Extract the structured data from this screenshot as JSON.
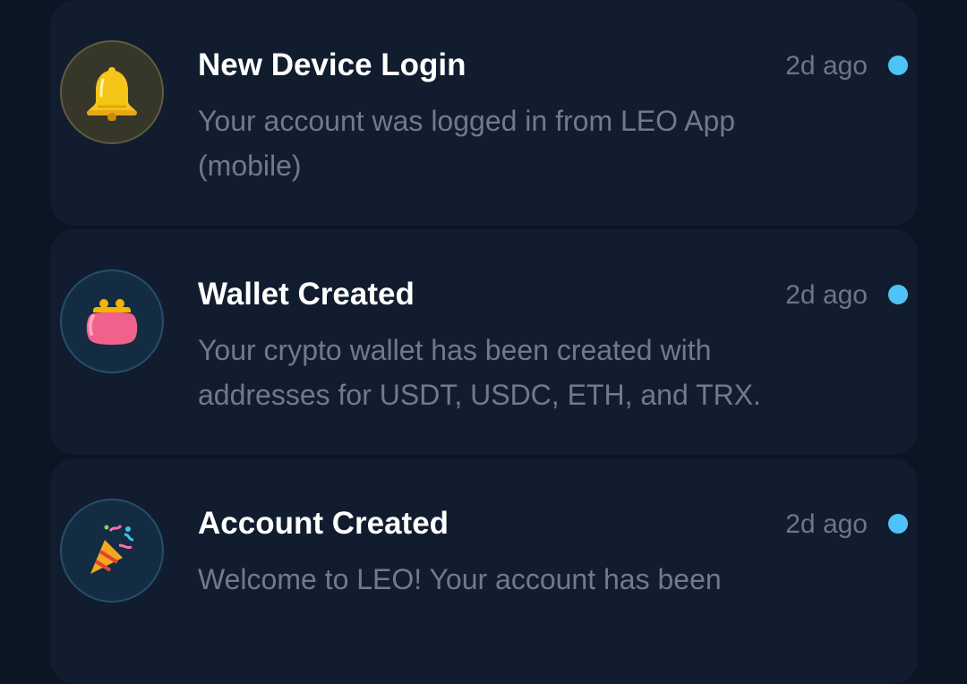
{
  "notifications": [
    {
      "title": "New Device Login",
      "time": "2d ago",
      "body": "Your account was logged in from LEO App (mobile)",
      "icon": "bell-icon",
      "unread": true
    },
    {
      "title": "Wallet Created",
      "time": "2d ago",
      "body": "Your crypto wallet has been created with addresses for USDT, USDC, ETH, and TRX.",
      "icon": "purse-icon",
      "unread": true
    },
    {
      "title": "Account Created",
      "time": "2d ago",
      "body": "Welcome to LEO! Your account has been",
      "icon": "party-popper-icon",
      "unread": true
    }
  ],
  "colors": {
    "background": "#0c1524",
    "card": "#111d2e",
    "unread_dot": "#4fc3f7",
    "title": "#ffffff",
    "secondary_text": "#6e7b8b"
  }
}
